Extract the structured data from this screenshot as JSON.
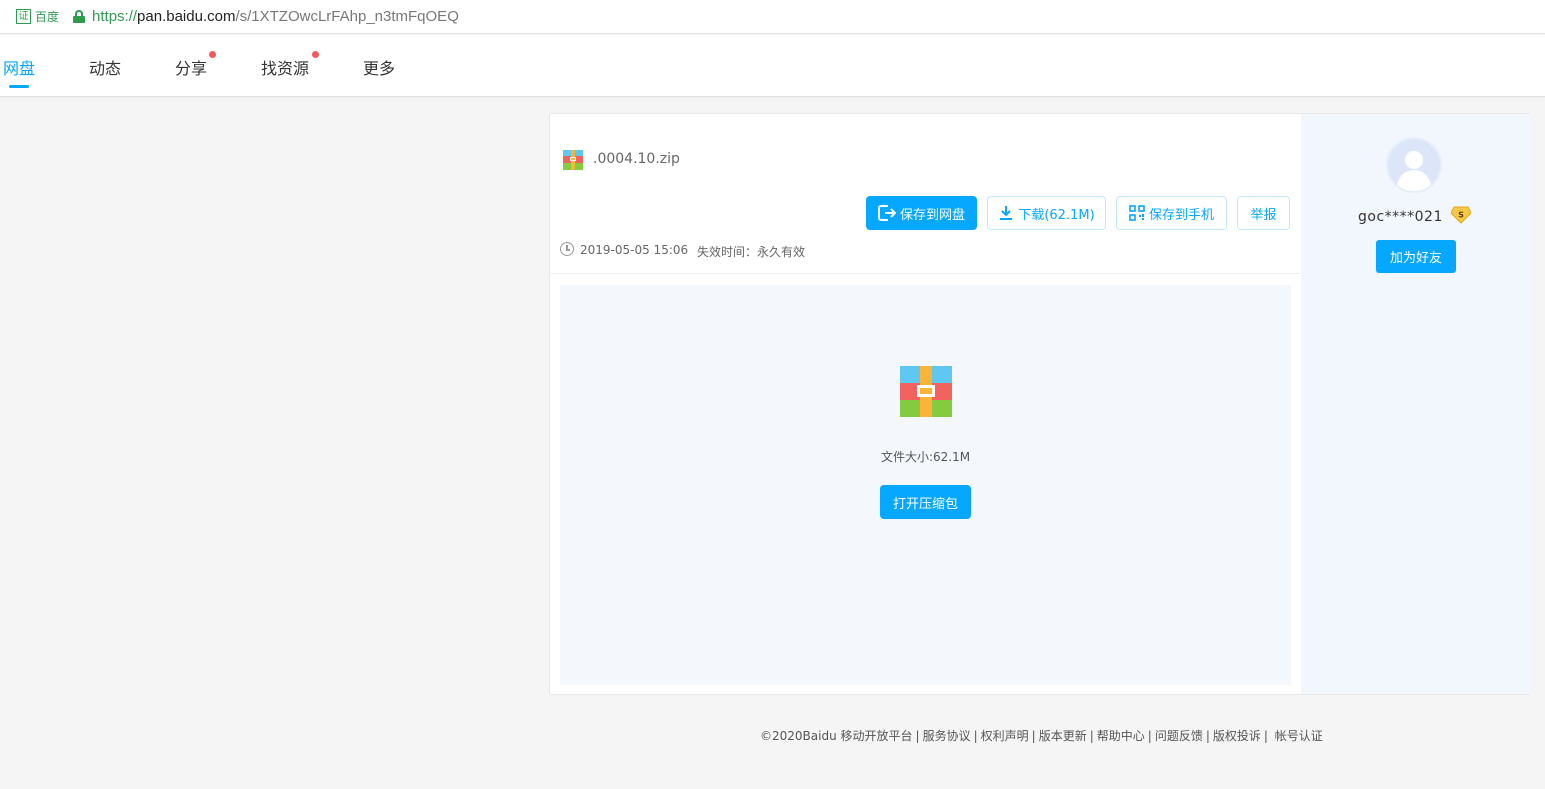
{
  "address_bar": {
    "cert_icon": "证",
    "cert_label": "百度",
    "url_scheme": "https://",
    "url_host": "pan.baidu.com",
    "url_path": "/s/1XTZOwcLrFAhp_n3tmFqOEQ"
  },
  "nav": {
    "items": [
      {
        "label": "网盘",
        "active": true
      },
      {
        "label": "动态"
      },
      {
        "label": "分享",
        "badge": true
      },
      {
        "label": "找资源",
        "badge": true
      },
      {
        "label": "更多"
      }
    ]
  },
  "file": {
    "name": ".0004.10.zip",
    "created": "2019-05-05 15:06",
    "expire": "失效时间：永久有效",
    "size_text": "文件大小:62.1M"
  },
  "actions": {
    "save_to_disk": "保存到网盘",
    "download": "下载(62.1M)",
    "save_to_phone": "保存到手机",
    "report": "举报",
    "open_archive": "打开压缩包"
  },
  "sidebar": {
    "username": "goc****021",
    "add_friend": "加为好友",
    "vip_badge": "S"
  },
  "footer": {
    "copyright": "©2020Baidu",
    "links": [
      "移动开放平台",
      "服务协议",
      "权利声明",
      "版本更新",
      "帮助中心",
      "问题反馈",
      "版权投诉",
      "帐号认证"
    ]
  },
  "colors": {
    "accent": "#06a7ff",
    "secure_green": "#2e9c4f",
    "badge_red": "#f05a5a",
    "sidebar_bg": "#f2f6fd"
  },
  "icons": [
    "lock-icon",
    "clock-icon",
    "zip-file-icon",
    "download-icon",
    "qrcode-icon",
    "save-to-disk-icon",
    "vip-badge-icon",
    "avatar-icon"
  ]
}
